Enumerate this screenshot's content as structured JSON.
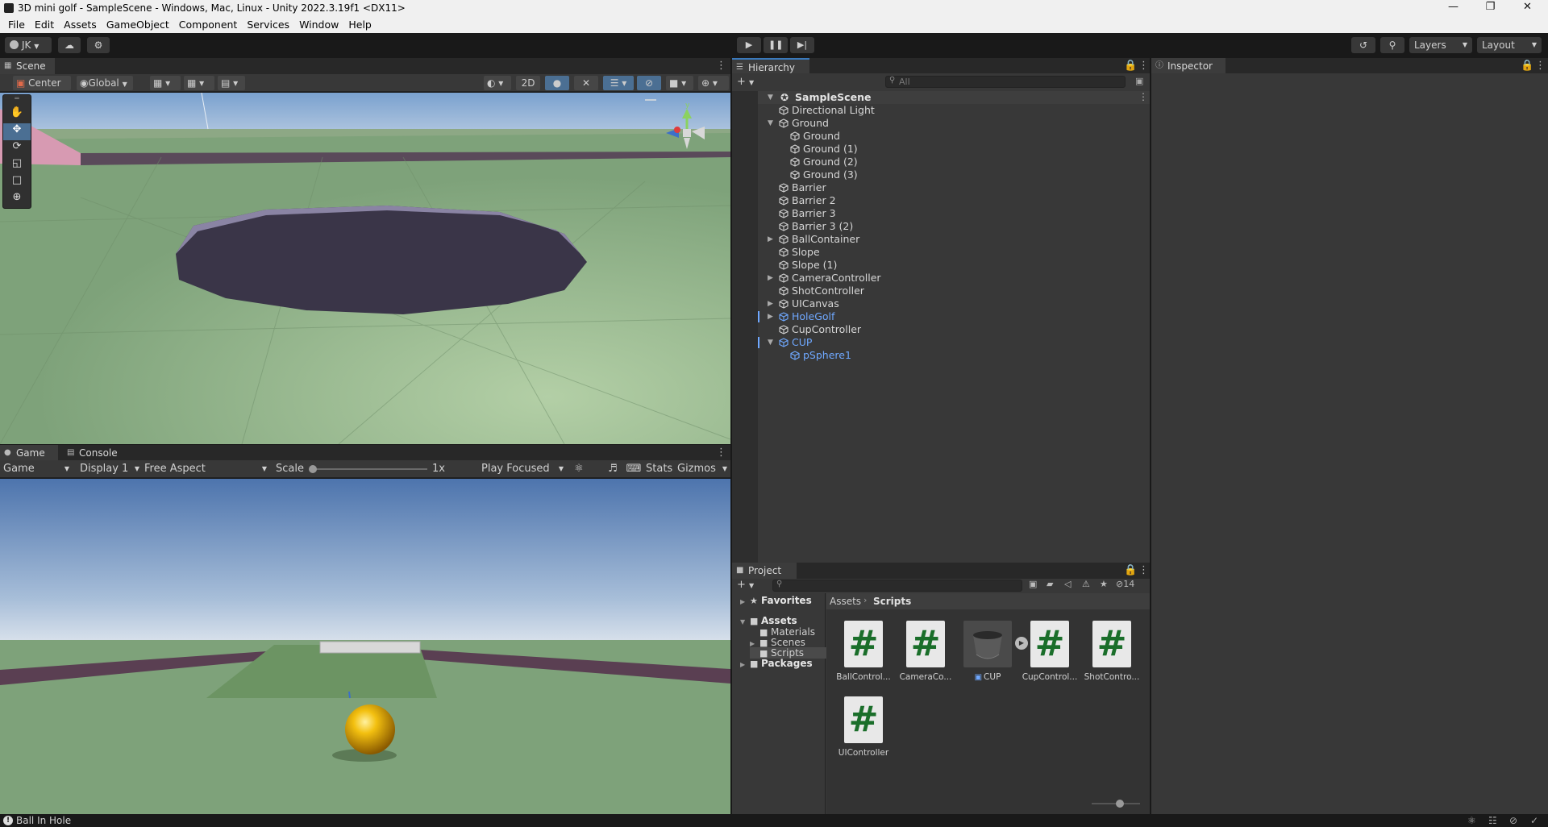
{
  "window": {
    "title": "3D mini golf - SampleScene - Windows, Mac, Linux - Unity 2022.3.19f1 <DX11>"
  },
  "menu": [
    "File",
    "Edit",
    "Assets",
    "GameObject",
    "Component",
    "Services",
    "Window",
    "Help"
  ],
  "toolbar": {
    "account": "JK",
    "layers": "Layers",
    "layout": "Layout"
  },
  "scene": {
    "tab": "Scene",
    "pivot": "Center",
    "space": "Global",
    "mode2d": "2D",
    "gizmo_axis": "y"
  },
  "game": {
    "tabs": [
      "Game",
      "Console"
    ],
    "view": "Game",
    "display": "Display 1",
    "aspect": "Free Aspect",
    "scale_label": "Scale",
    "scale_value": "1x",
    "play_mode": "Play Focused",
    "stats": "Stats",
    "gizmos": "Gizmos"
  },
  "hierarchy": {
    "tab": "Hierarchy",
    "search_placeholder": "All",
    "scene_name": "SampleScene",
    "items": [
      {
        "label": "Directional Light",
        "depth": 1,
        "expand": "",
        "prefab": false
      },
      {
        "label": "Ground",
        "depth": 1,
        "expand": "open",
        "prefab": false
      },
      {
        "label": "Ground",
        "depth": 2,
        "expand": "",
        "prefab": false
      },
      {
        "label": "Ground (1)",
        "depth": 2,
        "expand": "",
        "prefab": false
      },
      {
        "label": "Ground (2)",
        "depth": 2,
        "expand": "",
        "prefab": false
      },
      {
        "label": "Ground (3)",
        "depth": 2,
        "expand": "",
        "prefab": false
      },
      {
        "label": "Barrier",
        "depth": 1,
        "expand": "",
        "prefab": false
      },
      {
        "label": "Barrier 2",
        "depth": 1,
        "expand": "",
        "prefab": false
      },
      {
        "label": "Barrier 3",
        "depth": 1,
        "expand": "",
        "prefab": false
      },
      {
        "label": "Barrier 3 (2)",
        "depth": 1,
        "expand": "",
        "prefab": false
      },
      {
        "label": "BallContainer",
        "depth": 1,
        "expand": "closed",
        "prefab": false
      },
      {
        "label": "Slope",
        "depth": 1,
        "expand": "",
        "prefab": false
      },
      {
        "label": "Slope (1)",
        "depth": 1,
        "expand": "",
        "prefab": false
      },
      {
        "label": "CameraController",
        "depth": 1,
        "expand": "closed",
        "prefab": false
      },
      {
        "label": "ShotController",
        "depth": 1,
        "expand": "",
        "prefab": false
      },
      {
        "label": "UICanvas",
        "depth": 1,
        "expand": "closed",
        "prefab": false
      },
      {
        "label": "HoleGolf",
        "depth": 1,
        "expand": "closed",
        "prefab": true
      },
      {
        "label": "CupController",
        "depth": 1,
        "expand": "",
        "prefab": false
      },
      {
        "label": "CUP",
        "depth": 1,
        "expand": "open",
        "prefab": true
      },
      {
        "label": "pSphere1",
        "depth": 2,
        "expand": "",
        "prefab": true
      }
    ]
  },
  "inspector": {
    "tab": "Inspector"
  },
  "project": {
    "tab": "Project",
    "hidden_count": "14",
    "breadcrumb": [
      "Assets",
      "Scripts"
    ],
    "tree": [
      {
        "label": "Favorites",
        "depth": 0,
        "bold": true,
        "icon": "star-icon"
      },
      {
        "label": "Assets",
        "depth": 0,
        "bold": true,
        "icon": "folder-icon"
      },
      {
        "label": "Materials",
        "depth": 1,
        "bold": false,
        "icon": "folder-icon"
      },
      {
        "label": "Scenes",
        "depth": 1,
        "bold": false,
        "icon": "folder-icon"
      },
      {
        "label": "Scripts",
        "depth": 1,
        "bold": false,
        "icon": "folder-icon"
      },
      {
        "label": "Packages",
        "depth": 0,
        "bold": true,
        "icon": "folder-icon"
      }
    ],
    "assets": [
      {
        "label": "BallControl...",
        "type": "script"
      },
      {
        "label": "CameraCo...",
        "type": "script"
      },
      {
        "label": "CUP",
        "type": "prefab"
      },
      {
        "label": "CupControl...",
        "type": "script"
      },
      {
        "label": "ShotContro...",
        "type": "script"
      },
      {
        "label": "UIController",
        "type": "script"
      }
    ]
  },
  "status": {
    "message": "Ball In Hole"
  }
}
